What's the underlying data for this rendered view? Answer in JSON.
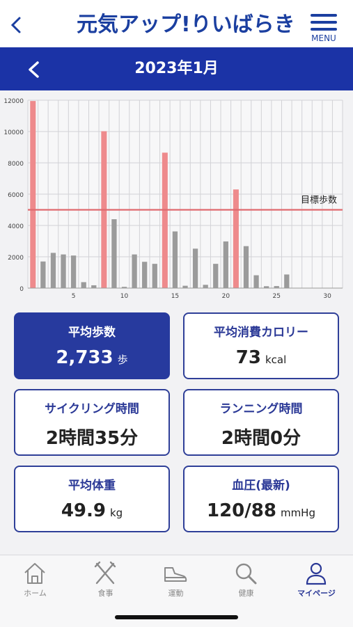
{
  "header": {
    "logo": "元気アップ!りいばらき",
    "menu_label": "MENU",
    "month_title": "2023年1月"
  },
  "chart_data": {
    "type": "bar",
    "x": [
      1,
      2,
      3,
      4,
      5,
      6,
      7,
      8,
      9,
      10,
      11,
      12,
      13,
      14,
      15,
      16,
      17,
      18,
      19,
      20,
      21,
      22,
      23,
      24,
      25,
      26,
      27,
      28,
      29,
      30,
      31
    ],
    "values": [
      11950,
      1700,
      2250,
      2150,
      2080,
      380,
      180,
      10020,
      4400,
      80,
      2150,
      1680,
      1550,
      8650,
      3620,
      150,
      2520,
      210,
      1550,
      2980,
      6300,
      2680,
      820,
      120,
      130,
      870,
      0,
      0,
      0,
      0,
      0
    ],
    "highlight_days": [
      1,
      8,
      14,
      21
    ],
    "x_ticks": [
      "5",
      "10",
      "15",
      "20",
      "25",
      "30"
    ],
    "x_tick_values": [
      5,
      10,
      15,
      20,
      25,
      30
    ],
    "y_ticks": [
      "0",
      "2000",
      "4000",
      "6000",
      "8000",
      "10000",
      "12000"
    ],
    "y_tick_values": [
      0,
      2000,
      4000,
      6000,
      8000,
      10000,
      12000
    ],
    "ylim": [
      0,
      12000
    ],
    "target": {
      "value": 5000,
      "label": "目標歩数"
    },
    "colors": {
      "normal": "#9b9b9b",
      "highlight": "#ee8a8c",
      "target": "#e06a6f"
    },
    "grid": true
  },
  "stats": {
    "avg_steps": {
      "title": "平均歩数",
      "value": "2,733",
      "unit": "歩"
    },
    "avg_calories": {
      "title": "平均消費カロリー",
      "value": "73",
      "unit": "kcal"
    },
    "cycling_time": {
      "title": "サイクリング時間",
      "value": "2時間35分",
      "unit": ""
    },
    "running_time": {
      "title": "ランニング時間",
      "value": "2時間0分",
      "unit": ""
    },
    "avg_weight": {
      "title": "平均体重",
      "value": "49.9",
      "unit": "kg"
    },
    "blood_pressure": {
      "title": "血圧(最新)",
      "value": "120/88",
      "unit": "mmHg"
    }
  },
  "tabs": [
    {
      "label": "ホーム",
      "icon": "home-icon"
    },
    {
      "label": "食事",
      "icon": "fork-knife-icon"
    },
    {
      "label": "運動",
      "icon": "shoe-icon"
    },
    {
      "label": "健康",
      "icon": "search-icon"
    },
    {
      "label": "マイページ",
      "icon": "person-icon",
      "active": true
    }
  ]
}
